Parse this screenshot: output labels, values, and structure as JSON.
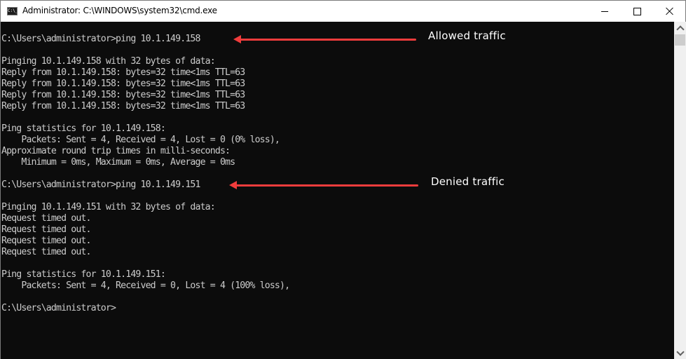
{
  "window": {
    "title": "Administrator: C:\\WINDOWS\\system32\\cmd.exe",
    "app_icon": "cmd-icon",
    "app_icon_text": "C:\\_",
    "controls": {
      "minimize": "minimize-icon",
      "maximize": "maximize-icon",
      "close": "close-icon"
    }
  },
  "console": {
    "lines": [
      "C:\\Users\\administrator>ping 10.1.149.158",
      "",
      "Pinging 10.1.149.158 with 32 bytes of data:",
      "Reply from 10.1.149.158: bytes=32 time<1ms TTL=63",
      "Reply from 10.1.149.158: bytes=32 time<1ms TTL=63",
      "Reply from 10.1.149.158: bytes=32 time<1ms TTL=63",
      "Reply from 10.1.149.158: bytes=32 time<1ms TTL=63",
      "",
      "Ping statistics for 10.1.149.158:",
      "    Packets: Sent = 4, Received = 4, Lost = 0 (0% loss),",
      "Approximate round trip times in milli-seconds:",
      "    Minimum = 0ms, Maximum = 0ms, Average = 0ms",
      "",
      "C:\\Users\\administrator>ping 10.1.149.151",
      "",
      "Pinging 10.1.149.151 with 32 bytes of data:",
      "Request timed out.",
      "Request timed out.",
      "Request timed out.",
      "Request timed out.",
      "",
      "Ping statistics for 10.1.149.151:",
      "    Packets: Sent = 4, Received = 0, Lost = 4 (100% loss),",
      "",
      "C:\\Users\\administrator>"
    ],
    "text_color": "#cccccc",
    "background_color": "#0c0c0c"
  },
  "annotations": [
    {
      "label": "Allowed traffic",
      "color": "#f03c3c"
    },
    {
      "label": "Denied traffic",
      "color": "#f03c3c"
    }
  ],
  "scrollbar": {
    "up": "chevron-up-icon",
    "down": "chevron-down-icon"
  }
}
